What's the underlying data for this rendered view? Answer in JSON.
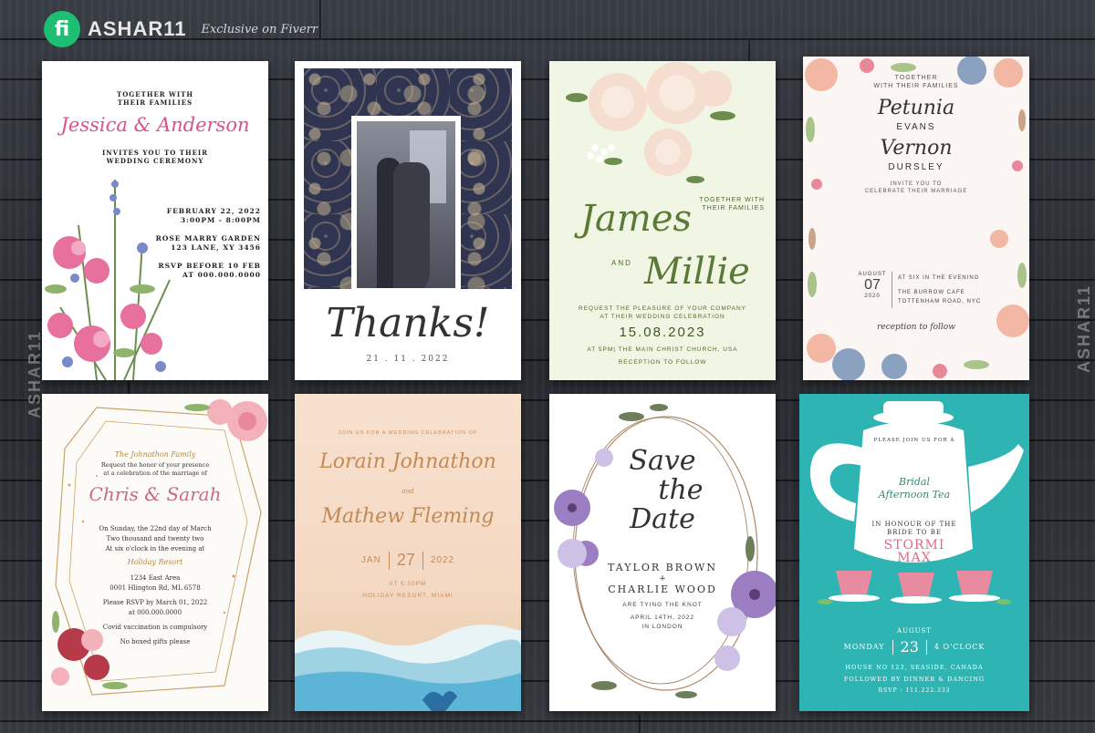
{
  "brand": {
    "logo_text": "fi",
    "name": "ASHAR11",
    "tagline": "Exclusive on Fiverr",
    "side_watermark": "ASHAR11"
  },
  "cards": {
    "c1": {
      "together": "TOGETHER WITH",
      "families": "THEIR FAMILIES",
      "names": "Jessica & Anderson",
      "invites": "INVITES YOU TO THEIR",
      "ceremony": "WEDDING CEREMONY",
      "date": "FEBRUARY 22, 2022",
      "time": "3:00PM - 8:00PM",
      "venue": "ROSE MARRY GARDEN",
      "address": "123 LANE, XY 3456",
      "rsvp": "RSVP BEFORE 10 FEB",
      "phone": "AT 000.000.0000"
    },
    "c2": {
      "thanks": "Thanks!",
      "date": "21 . 11 . 2022"
    },
    "c3": {
      "together": "TOGETHER WITH",
      "families": "THEIR FAMILIES",
      "name1": "James",
      "and": "AND",
      "name2": "Millie",
      "request1": "REQUEST THE PLEASURE OF YOUR COMPANY",
      "request2": "AT THEIR WEDDING CELEBRATION",
      "date": "15.08.2023",
      "venue": "AT 5PM| THE MAIN CHRIST CHURCH, USA",
      "reception": "RECEPTION TO FOLLOW"
    },
    "c4": {
      "together": "TOGETHER",
      "families": "WITH THEIR FAMILIES",
      "first1": "Petunia",
      "last1": "EVANS",
      "first2": "Vernon",
      "last2": "DURSLEY",
      "invite1": "INVITE YOU TO",
      "invite2": "CELEBRATE THEIR MARRIAGE",
      "month": "AUGUST",
      "day": "07",
      "year": "2020",
      "time": "AT SIX IN THE EVENING",
      "venue1": "THE BURROW CAFE",
      "venue2": "TOTTENHAM ROAD, NYC",
      "reception": "reception to follow"
    },
    "c5": {
      "family": "The Johnathon Family",
      "request1": "Request the honor of your presence",
      "request2": "at a celebration of the marriage of",
      "names": "Chris & Sarah",
      "when1": "On Sunday, the 22nd day of March",
      "when2": "Two thousand and twenty two",
      "when3": "At six o'clock in the evening at",
      "venue": "Holiday Resort",
      "addr1": "1234 East Area",
      "addr2": "0001 Hlington Rd, ML 6578",
      "rsvp1": "Please RSVP by March 01, 2022",
      "rsvp2": "at 000.000.0000",
      "covid": "Covid vaccination is compulsory",
      "gifts": "No boxed gifts please"
    },
    "c6": {
      "join": "JOIN US FOR A WEDDING CELEBRATION OF",
      "name1": "Lorain Johnathon",
      "and": "and",
      "name2": "Mathew Fleming",
      "month": "JAN",
      "day": "27",
      "year": "2022",
      "time": "AT 5:00PM",
      "venue": "HOLIDAY RESORT, MIAMI"
    },
    "c7": {
      "save1": "Save",
      "save2": "the",
      "save3": "Date",
      "name1": "TAYLOR BROWN",
      "plus": "+",
      "name2": "CHARLIE WOOD",
      "tying": "ARE TYING THE KNOT",
      "date": "APRIL 14TH, 2022",
      "place": "IN LONDON"
    },
    "c8": {
      "join": "PLEASE JOIN US FOR A",
      "title1": "Bridal",
      "title2": "Afternoon Tea",
      "honour1": "IN HONOUR OF THE",
      "honour2": "BRIDE TO BE",
      "bride1": "STORMI",
      "bride2": "MAX",
      "month": "AUGUST",
      "weekday": "MONDAY",
      "day": "23",
      "time": "4 O'CLOCK",
      "addr": "HOUSE NO 123, SEASIDE, CANADA",
      "follow": "FOLLOWED BY DINNER & DANCING",
      "rsvp": "RSVP : 111.222.333"
    }
  }
}
